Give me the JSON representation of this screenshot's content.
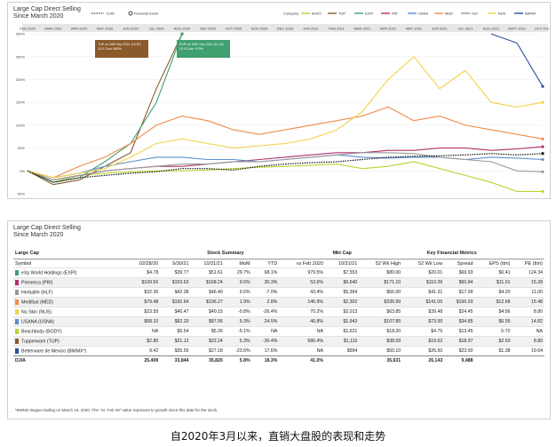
{
  "chart": {
    "title_line1": "Large Cap Direct Selling",
    "title_line2": "Since March 2020",
    "legend_left": [
      {
        "label": "DJIA",
        "key": "djia"
      },
      {
        "label": "Financial Event",
        "key": "event"
      }
    ],
    "legend_group_label": "Company",
    "annotations": [
      {
        "text": "TUP on 30th Sep 2021 (10.87)\n10.0 Cum: 680%",
        "color": "#8a5a2b"
      },
      {
        "text": "EXPI on 30th Sep 2021 (11.33)\n10.0 Cum: 979%",
        "color": "#3f9f6f"
      }
    ]
  },
  "chart_data": {
    "type": "line",
    "x": [
      "FEB 2020",
      "MAR 2020",
      "APR 2020",
      "MAY 2020",
      "JUN 2020",
      "JUL 2020",
      "AUG 2020",
      "SEP 2020",
      "OCT 2020",
      "NOV 2020",
      "DEC 2020",
      "JAN 2021",
      "FEB 2021",
      "MAR 2021",
      "APR 2021",
      "MAY 2021",
      "JUN 2021",
      "JUL 2021",
      "AUG 2021",
      "SEPT 2021",
      "OCT 2021"
    ],
    "y_ticks": [
      "-50%",
      "0%",
      "50%",
      "100%",
      "150%",
      "200%",
      "250%",
      "300%"
    ],
    "ylim": [
      -50,
      310
    ],
    "series": [
      {
        "name": "BODY",
        "color": "#b8d432",
        "values": [
          0,
          -25,
          -10,
          -5,
          -2,
          0,
          0,
          2,
          5,
          8,
          10,
          12,
          15,
          5,
          10,
          20,
          5,
          -10,
          -25,
          -45,
          -45
        ]
      },
      {
        "name": "TUP",
        "color": "#8a5a2b",
        "values": [
          0,
          -30,
          -20,
          10,
          40,
          180,
          300,
          null,
          null,
          null,
          null,
          null,
          null,
          null,
          null,
          null,
          null,
          null,
          null,
          null,
          null
        ]
      },
      {
        "name": "EXPI",
        "color": "#3f9f6f",
        "values": [
          0,
          -25,
          -15,
          20,
          60,
          150,
          300,
          null,
          null,
          null,
          null,
          null,
          null,
          null,
          null,
          null,
          null,
          null,
          null,
          null,
          null
        ]
      },
      {
        "name": "PRI",
        "color": "#b0306b",
        "values": [
          0,
          -20,
          -10,
          0,
          5,
          10,
          10,
          15,
          20,
          25,
          30,
          35,
          40,
          40,
          45,
          45,
          50,
          50,
          45,
          48,
          53
        ]
      },
      {
        "name": "USNA",
        "color": "#5b8fd0",
        "values": [
          0,
          -15,
          -5,
          10,
          20,
          30,
          30,
          25,
          25,
          20,
          25,
          30,
          35,
          30,
          28,
          30,
          30,
          25,
          30,
          28,
          25
        ]
      },
      {
        "name": "MED",
        "color": "#f08a4b",
        "values": [
          0,
          -15,
          10,
          30,
          60,
          100,
          120,
          110,
          90,
          80,
          90,
          100,
          110,
          120,
          140,
          110,
          120,
          100,
          90,
          80,
          70
        ]
      },
      {
        "name": "HLF",
        "color": "#999999",
        "values": [
          0,
          -20,
          -10,
          0,
          5,
          10,
          15,
          15,
          20,
          20,
          25,
          30,
          35,
          40,
          40,
          38,
          30,
          25,
          20,
          0,
          -2
        ]
      },
      {
        "name": "NUS",
        "color": "#f2d24a",
        "values": [
          0,
          -15,
          -5,
          5,
          30,
          60,
          70,
          60,
          50,
          55,
          60,
          70,
          90,
          130,
          200,
          250,
          180,
          220,
          150,
          140,
          150
        ]
      },
      {
        "name": "BWMX",
        "color": "#2a4f9a",
        "values": [
          null,
          null,
          null,
          null,
          null,
          null,
          null,
          null,
          null,
          null,
          null,
          null,
          null,
          null,
          null,
          null,
          null,
          null,
          300,
          280,
          185
        ]
      },
      {
        "name": "DJIA",
        "color": "#111111",
        "dashed": true,
        "values": [
          0,
          -25,
          -15,
          -10,
          -5,
          -2,
          5,
          5,
          2,
          10,
          15,
          18,
          20,
          25,
          30,
          32,
          33,
          35,
          38,
          35,
          38
        ]
      }
    ]
  },
  "table": {
    "title_line1": "Large Cap Direct Selling",
    "title_line2": "Since March 2020",
    "group_headers": {
      "large_cap": "Large Cap",
      "stock_summary": "Stock Summary",
      "mkt_cap": "Mkt Cap",
      "key_metrics": "Key Financial Metrics"
    },
    "columns": [
      "Symbol",
      "02/28/20",
      "9/30/21",
      "10/31/21",
      "MoM",
      "YTD",
      "vs Feb 2020",
      "10/31/21",
      "52 Wk High",
      "52 Wk Low",
      "Spread",
      "EPS (ttm)",
      "PE (ttm)"
    ],
    "rows": [
      {
        "color": "#3f9f6f",
        "cells": [
          "eXp World Holdings (EXPI)",
          "$4.78",
          "$39.77",
          "$51.61",
          "29.7%",
          "68.1%",
          "979.5%",
          "$7,553",
          "$80.00",
          "$20.01",
          "$69.93",
          "$0.41",
          "124.34"
        ]
      },
      {
        "color": "#b0306b",
        "cells": [
          "Primerica (PRI)",
          "$109.56",
          "$153.63",
          "$168.24",
          "9.5%",
          "30.3%",
          "53.6%",
          "$6,640",
          "$171.10",
          "$110.26",
          "$60.84",
          "$11.01",
          "15.28"
        ]
      },
      {
        "color": "#999999",
        "cells": [
          "Herbalife (HLF)",
          "$32.30",
          "$42.38",
          "$46.40",
          "9.5%",
          "-7.0%",
          "43.4%",
          "$5,364",
          "$56.00",
          "$41.31",
          "$17.09",
          "$4.20",
          "11.00"
        ]
      },
      {
        "color": "#f08a4b",
        "cells": [
          "Medifast (MED)",
          "$79.48",
          "$192.64",
          "$196.27",
          "1.9%",
          "2.8%",
          "146.9%",
          "$2,302",
          "$336.99",
          "$141.05",
          "$195.03",
          "$12.68",
          "15.48"
        ]
      },
      {
        "color": "#f2d24a",
        "cells": [
          "Nu Skin (NUS)",
          "$23.59",
          "$40.47",
          "$40.15",
          "-0.8%",
          "-26.4%",
          "70.2%",
          "$2,013",
          "$63.85",
          "$39.48",
          "$24.45",
          "$4.56",
          "8.80"
        ]
      },
      {
        "color": "#5b8fd0",
        "cells": [
          "USANA (USNA)",
          "$68.10",
          "$82.20",
          "$87.06",
          "5.3%",
          "24.5%",
          "46.8%",
          "$1,943",
          "$107.85",
          "$73.00",
          "$34.85",
          "$6.55",
          "14.82"
        ]
      },
      {
        "color": "#b8d432",
        "cells": [
          "Beachbody (BODY)",
          "NA",
          "$5.54",
          "$5.26",
          "-5.1%",
          "NA",
          "NA",
          "$1,621",
          "$18.20",
          "$4.75",
          "$13.45",
          "5-70",
          "NA"
        ]
      },
      {
        "color": "#8a5a2b",
        "cells": [
          "Tupperware (TUP)",
          "$2.85",
          "$21.12",
          "$22.24",
          "5.3%",
          "-30.4%",
          "680.4%",
          "$1,110",
          "$38.59",
          "$18.62",
          "$18.97",
          "$2.53",
          "8.80"
        ]
      },
      {
        "color": "#2a4f9a",
        "cells": [
          "Betterware de Mexico (BWMX*)",
          "9.42",
          "$35.56",
          "$27.18",
          "-23.6%",
          "17.6%",
          "NA",
          "$994",
          "$50.10",
          "$26.50",
          "$23.60",
          "$1.38",
          "19.64"
        ]
      }
    ],
    "djia_row": [
      "DJIA",
      "25,409",
      "33,844",
      "35,820",
      "5.8%",
      "18.3%",
      "41.0%",
      "",
      "35,631",
      "26,143",
      "9,488",
      "",
      ""
    ],
    "footnote": "*BWMX Began trading on March 10, 2020. The \"vs. Feb 20\" value represent to growth since this date for the stock."
  },
  "caption": "自2020年3月以来，直销大盘股的表现和走势"
}
